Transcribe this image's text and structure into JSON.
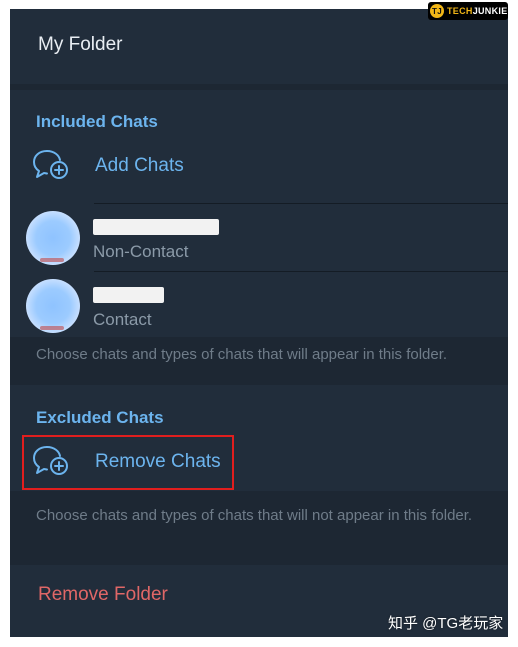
{
  "header": {
    "title": "My Folder"
  },
  "included": {
    "title": "Included Chats",
    "add_label": "Add Chats",
    "contacts": [
      {
        "subtitle": "Non-Contact"
      },
      {
        "subtitle": "Contact"
      }
    ],
    "hint": "Choose chats and types of chats that will appear in this folder."
  },
  "excluded": {
    "title": "Excluded Chats",
    "remove_label": "Remove Chats",
    "hint": "Choose chats and types of chats that will not appear in this folder."
  },
  "footer": {
    "remove_folder": "Remove Folder"
  },
  "branding": {
    "logo_tj": "TJ",
    "logo_tech": "TECH",
    "logo_junkie": "JUNKIE",
    "watermark": "知乎 @TG老玩家"
  },
  "colors": {
    "accent": "#6cb4ee",
    "danger": "#e06767",
    "background": "#1d2733",
    "panel": "#212d3b",
    "highlight": "#e11e1e"
  },
  "icons": {
    "add_chat": "chat-bubble-plus-icon",
    "remove_chat": "chat-bubble-plus-icon"
  }
}
